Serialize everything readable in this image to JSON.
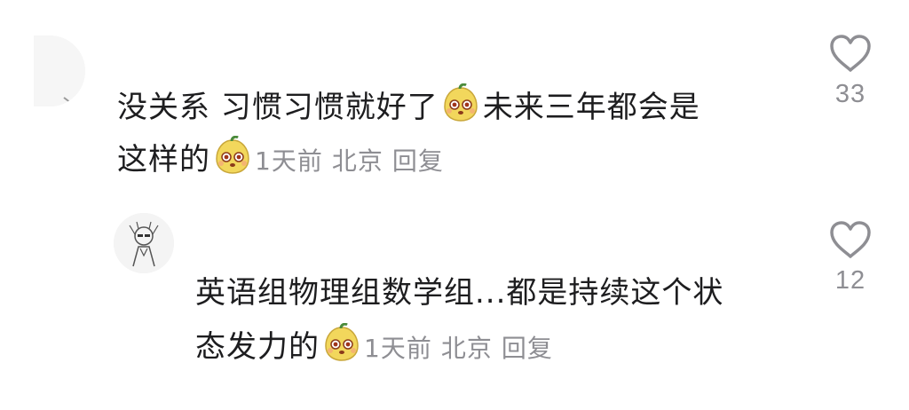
{
  "comments": [
    {
      "text_line1_a": "没关系 习惯习惯就好了",
      "text_line1_b": "未来三年都会是",
      "text_line2": "这样的",
      "emoji_icon": "mango-emoji-icon",
      "time": "1天前",
      "location": "北京",
      "reply_label": "回复",
      "like_count": "33"
    },
    {
      "text_line1": "英语组物理组数学组...都是持续这个状",
      "text_line2": "态发力的",
      "emoji_icon": "mango-emoji-icon",
      "time": "1天前",
      "location": "北京",
      "reply_label": "回复",
      "like_count": "12"
    }
  ],
  "colors": {
    "text": "#1d1d1f",
    "meta": "#8e8e93",
    "heart_outline": "#8e8e93",
    "emoji_fill": "#f2d75c"
  }
}
